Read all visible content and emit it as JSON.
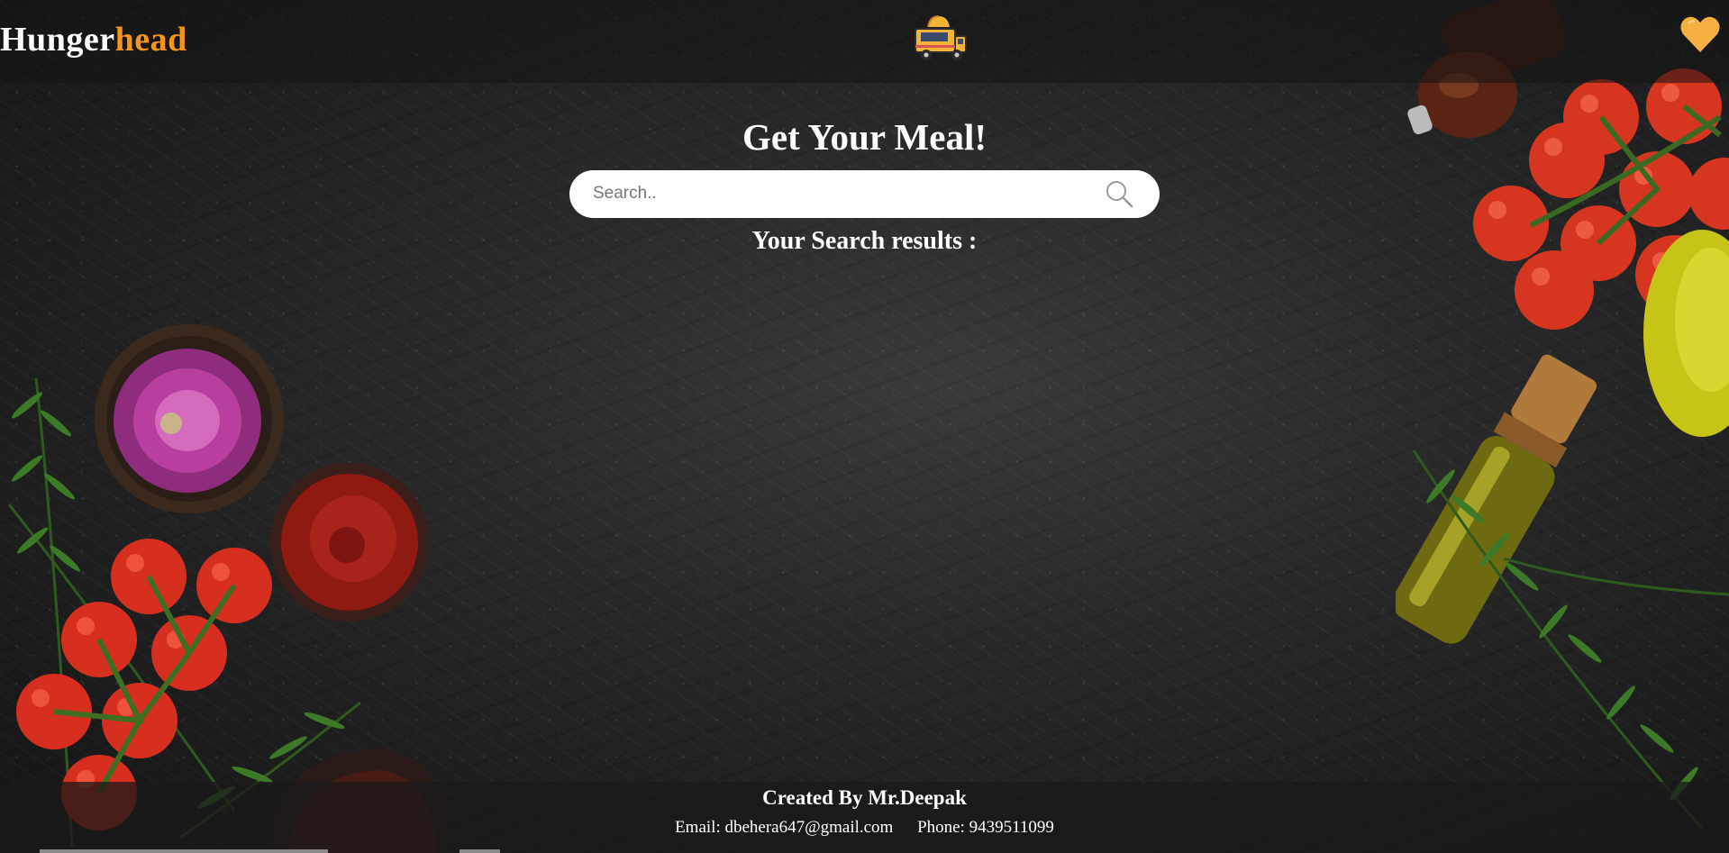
{
  "header": {
    "brand_white": "Hunger",
    "brand_orange": "head",
    "logo_icon": "food-truck-icon",
    "favorites_icon": "heart-icon"
  },
  "main": {
    "title": "Get Your Meal!",
    "search": {
      "placeholder": "Search..",
      "value": "",
      "icon": "search-icon"
    },
    "results_label": "Your Search results :"
  },
  "footer": {
    "credit": "Created By Mr.Deepak",
    "email": "Email: dbehera647@gmail.com",
    "phone": "Phone: 9439511099"
  },
  "colors": {
    "accent": "#f7941d",
    "heart": "#f5b041",
    "text": "#ffffff",
    "background": "#2a2a2a"
  }
}
